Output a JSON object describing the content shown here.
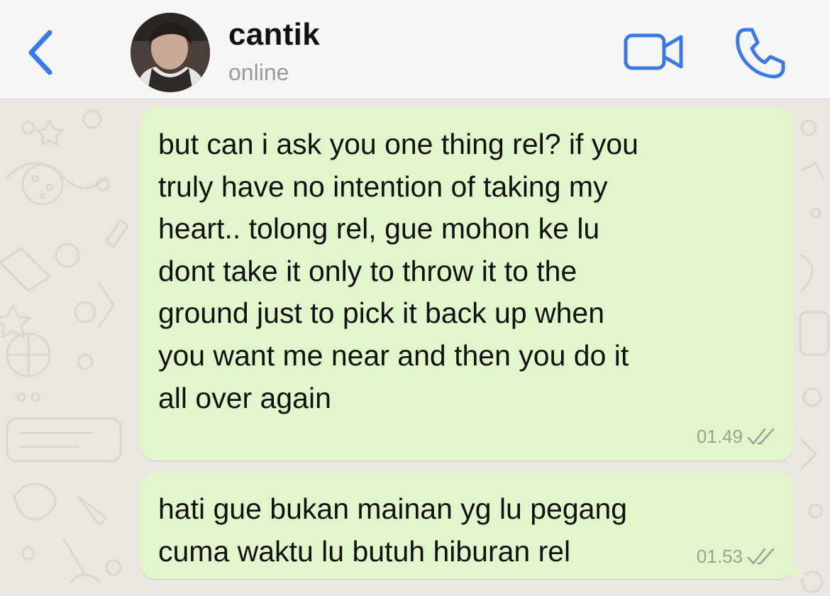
{
  "header": {
    "contact_name": "cantik",
    "status": "online",
    "icons": {
      "back": "chevron-left-icon",
      "video": "video-camera-icon",
      "call": "phone-icon"
    },
    "accent_color": "#3a7ae8"
  },
  "messages": [
    {
      "direction": "outgoing",
      "text": "but can i ask you one thing rel? if you\ntruly have no intention of taking my\nheart.. tolong rel, gue mohon ke lu\ndont take it only to throw it to the\nground just to pick it back up when\nyou want me near and then you do it\nall over again",
      "time": "01.49",
      "status_icon": "double-check-icon"
    },
    {
      "direction": "outgoing",
      "text": "hati gue bukan mainan yg lu pegang\ncuma waktu lu butuh hiburan rel",
      "time": "01.53",
      "status_icon": "double-check-icon"
    }
  ],
  "colors": {
    "outgoing_bubble": "#e1f6cb",
    "chat_background": "#ebe6df",
    "header_background": "#f6f6f6"
  }
}
